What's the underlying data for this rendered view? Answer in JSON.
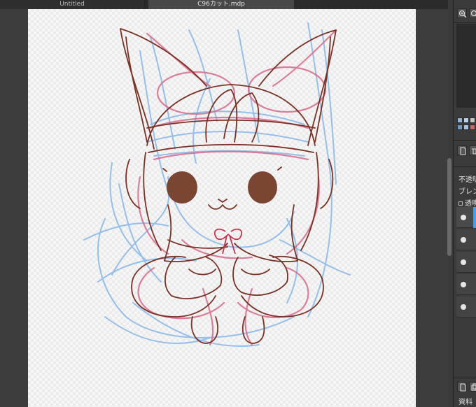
{
  "tabs": [
    {
      "label": "Untitled",
      "active": false
    },
    {
      "label": "C96カット.mdp",
      "active": true
    }
  ],
  "right_panel": {
    "zoom_in_icon": "zoom-in-icon",
    "zoom_out_icon": "zoom-out-icon",
    "palette_colors": [
      "#8fb4d6",
      "#b7d0e6",
      "#c6c6c6",
      "#8a2a2a",
      "#6a6a6a",
      "#c46a6a"
    ],
    "opacity_label": "不透明",
    "blend_label": "ブレンド",
    "protect_label": "透明",
    "bottom_label": "資料",
    "layer_count": 5,
    "selected_layer_index": 0
  },
  "colors": {
    "sketch_blue": "#84b7ea",
    "sketch_red": "#d86a8a",
    "lineart": "#7a3022",
    "face": "#7a4632",
    "ribbon": "#c8344e",
    "selection": "#4a9ee0"
  }
}
